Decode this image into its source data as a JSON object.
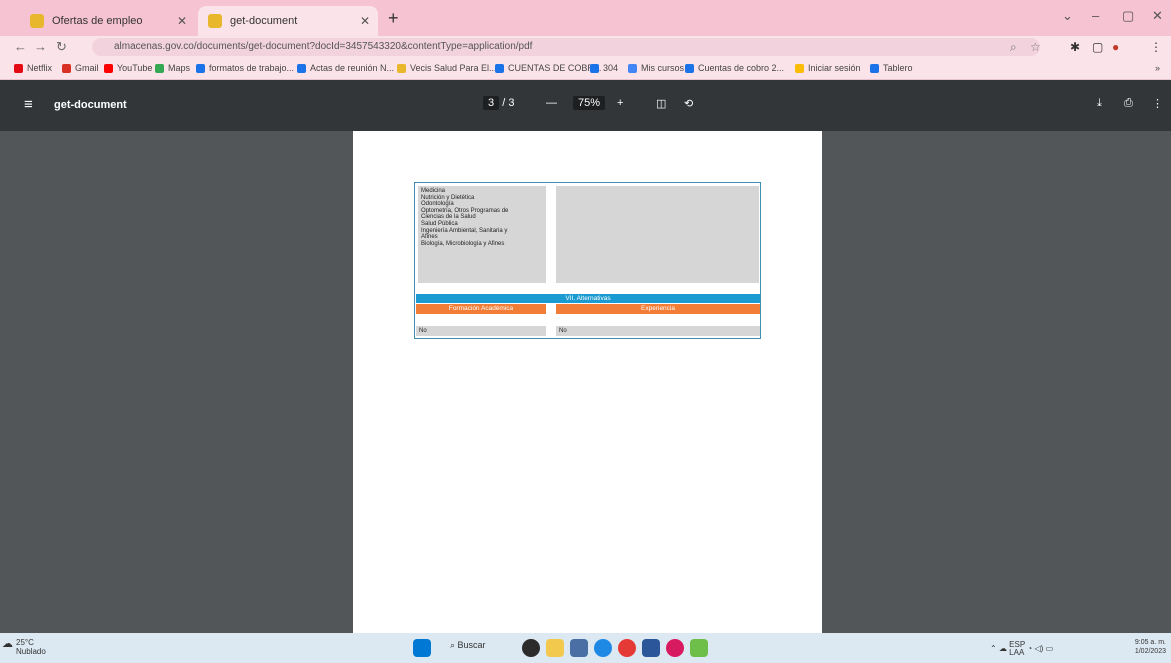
{
  "tabs": [
    {
      "label": "Ofertas de empleo",
      "active": false
    },
    {
      "label": "get-document",
      "active": true
    }
  ],
  "window": {
    "minimize": "–",
    "maximize": "▢",
    "close": "✕"
  },
  "toolbar": {
    "url": "almacenas.gov.co/documents/get-document?docId=3457543320&contentType=application/pdf"
  },
  "bookmarks": [
    {
      "label": "Netflix",
      "color": "#e50914"
    },
    {
      "label": "Gmail",
      "color": "#d93025"
    },
    {
      "label": "YouTube",
      "color": "#ff0000"
    },
    {
      "label": "Maps",
      "color": "#34a853"
    },
    {
      "label": "formatos de trabajo...",
      "color": "#1a73e8"
    },
    {
      "label": "Actas de reunión N...",
      "color": "#1a73e8"
    },
    {
      "label": "Vecis Salud Para El...",
      "color": "#e9b72b"
    },
    {
      "label": "CUENTAS DE COBR...",
      "color": "#1a73e8"
    },
    {
      "label": "304",
      "color": "#1a73e8"
    },
    {
      "label": "Mis cursos",
      "color": "#4285f4"
    },
    {
      "label": "Cuentas de cobro 2...",
      "color": "#1a73e8"
    },
    {
      "label": "Iniciar sesión",
      "color": "#fbbc05"
    },
    {
      "label": "Tablero",
      "color": "#1a73e8"
    }
  ],
  "pdf": {
    "title": "get-document",
    "page_current": "3",
    "page_sep": "/",
    "page_total": "3",
    "zoom": "75%",
    "minus": "—",
    "plus": "+"
  },
  "document": {
    "left_lines": [
      "Medicina",
      "Nutrición y Dietética",
      "Odontología",
      "Optometría, Otros Programas de",
      "Ciencias de la Salud",
      "Salud Pública",
      "Ingeniería Ambiental, Sanitaria y",
      "Afines",
      "Biología, Microbiología y Afines"
    ],
    "alternatives_header": "VII. Alternativas",
    "col_left": "Formación Académica",
    "col_right": "Experiencia",
    "no_left": "No",
    "no_right": "No"
  },
  "taskbar": {
    "temp": "25°C",
    "weather": "Nublado",
    "search": "Buscar",
    "lang": "ESP",
    "region": "LAA",
    "time": "9:05 a. m.",
    "date": "1/02/2023"
  }
}
